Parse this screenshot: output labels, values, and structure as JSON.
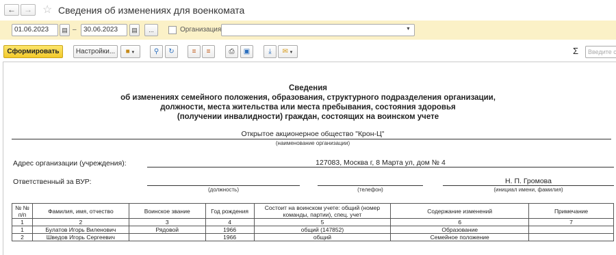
{
  "window": {
    "title": "Сведения об изменениях для военкомата",
    "back_icon": "arrow-left",
    "forward_icon": "arrow-right",
    "favorite_icon": "star"
  },
  "filters": {
    "date_from": "01.06.2023",
    "date_sep": "–",
    "date_to": "30.06.2023",
    "period_btn": "...",
    "org_label": "Организация:",
    "org_value": ""
  },
  "toolbar": {
    "generate": "Сформировать",
    "settings": "Настройки...",
    "sigma": "Σ",
    "search_placeholder": "Введите с"
  },
  "report": {
    "title": [
      "Сведения",
      "об изменениях семейного положения, образования, структурного подразделения организации,",
      "должности, места жительства или места пребывания, состояния здоровья",
      "(получении инвалидности) граждан, состоящих на воинском учете"
    ],
    "org_name": "Открытое акционерное общество \"Крон-Ц\"",
    "org_caption": "(наименование организации)",
    "address_label": "Адрес организации (учреждения):",
    "address_value": "127083, Москва г, 8 Марта ул, дом № 4",
    "responsible_label": "Ответственный за ВУР:",
    "responsible_name": "Н. П. Громова",
    "cap_position": "(должность)",
    "cap_phone": "(телефон)",
    "cap_initials": "(инициал имени, фамилия)",
    "columns": [
      "№ №\nп/п",
      "Фамилия, имя, отчество",
      "Воинское звание",
      "Год рождения",
      "Состоит на воинском учете: общий (номер команды, партии), спец. учет",
      "Содержание изменений",
      "Примечание"
    ],
    "numbers": [
      "1",
      "2",
      "3",
      "4",
      "5",
      "6",
      "7"
    ],
    "rows": [
      [
        "1",
        "Булатов Игорь Виленович",
        "Рядовой",
        "1966",
        "общий (147852)",
        "Образование",
        ""
      ],
      [
        "2",
        "Шведов Игорь Сергеевич",
        "",
        "1966",
        "общий",
        "Семейное положение",
        ""
      ]
    ]
  }
}
